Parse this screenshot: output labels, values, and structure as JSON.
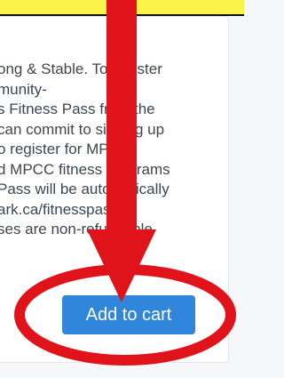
{
  "description_lines": [
    "ong & Stable. To register",
    "munity-",
    "s Fitness Pass from the",
    "can commit to signing up",
    "o register for MPCC",
    "d MPCC fitness programs",
    "Pass will be automatically",
    "ark.ca/fitnesspass.",
    "ses are non-refundable"
  ],
  "add_to_cart_label": "Add to cart",
  "colors": {
    "banner": "#fbf24a",
    "button": "#2f86db",
    "annotation": "#e0131a"
  },
  "annotations": {
    "arrow": "down-arrow",
    "ellipse": "highlight-ellipse"
  }
}
